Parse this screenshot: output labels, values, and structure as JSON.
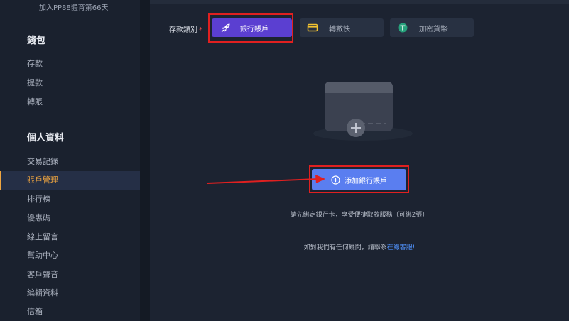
{
  "sidebar": {
    "join_text": "加入PP88體育第66天",
    "wallet_title": "錢包",
    "wallet_items": [
      {
        "label": "存款"
      },
      {
        "label": "提款"
      },
      {
        "label": "轉賬"
      }
    ],
    "profile_title": "個人資料",
    "profile_items": [
      {
        "label": "交易記錄"
      },
      {
        "label": "賬戶管理"
      },
      {
        "label": "排行榜"
      },
      {
        "label": "優惠碼"
      },
      {
        "label": "線上留言"
      },
      {
        "label": "幫助中心"
      },
      {
        "label": "客戶聲音"
      },
      {
        "label": "編輯資料"
      },
      {
        "label": "信箱"
      }
    ],
    "active_item": "賬戶管理"
  },
  "main": {
    "deposit_type_label": "存款類別",
    "required_mark": "*",
    "tabs": [
      {
        "label": "銀行賬戶",
        "icon": "rocket-icon",
        "active": true
      },
      {
        "label": "轉數快",
        "icon": "card-icon",
        "active": false
      },
      {
        "label": "加密貨幣",
        "icon": "tether-icon",
        "active": false
      }
    ],
    "illustration_icon": "empty-card-icon",
    "add_button_label": "添加銀行賬戶",
    "add_button_icon": "plus-circle-icon",
    "hint_text": "請先綁定銀行卡，享受便捷取款服務（可綁2張）",
    "contact_text": "如對我們有任何疑問，請聯系",
    "contact_link": "在線客服!"
  },
  "colors": {
    "accent_active_item": "#f0a640",
    "tab_active": "#5b3fd1",
    "button_primary": "#5a7ef0",
    "annotation_red": "#e02020",
    "link": "#4f8ff7"
  }
}
